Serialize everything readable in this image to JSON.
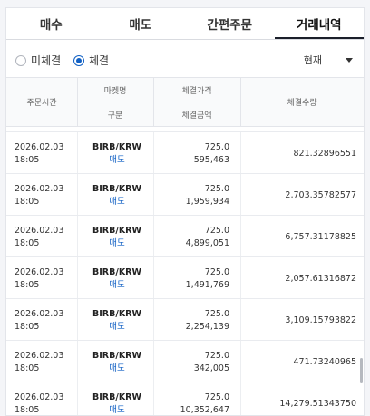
{
  "tabs": [
    {
      "label": "매수",
      "active": false
    },
    {
      "label": "매도",
      "active": false
    },
    {
      "label": "간편주문",
      "active": false
    },
    {
      "label": "거래내역",
      "active": true
    }
  ],
  "filter": {
    "unfilled_label": "미체결",
    "filled_label": "체결",
    "selected": "체결",
    "period_value": "현재"
  },
  "table_header": {
    "order_time": "주문시간",
    "market": "마켓명",
    "side": "구분",
    "price": "체결가격",
    "amount": "체결금액",
    "quantity": "체결수량"
  },
  "rows": [
    {
      "date": "2026.02.03",
      "time": "18:05",
      "market": "BIRB/KRW",
      "side": "매도",
      "price": "725.0",
      "amount": "595,463",
      "quantity": "821.32896551"
    },
    {
      "date": "2026.02.03",
      "time": "18:05",
      "market": "BIRB/KRW",
      "side": "매도",
      "price": "725.0",
      "amount": "1,959,934",
      "quantity": "2,703.35782577"
    },
    {
      "date": "2026.02.03",
      "time": "18:05",
      "market": "BIRB/KRW",
      "side": "매도",
      "price": "725.0",
      "amount": "4,899,051",
      "quantity": "6,757.31178825"
    },
    {
      "date": "2026.02.03",
      "time": "18:05",
      "market": "BIRB/KRW",
      "side": "매도",
      "price": "725.0",
      "amount": "1,491,769",
      "quantity": "2,057.61316872"
    },
    {
      "date": "2026.02.03",
      "time": "18:05",
      "market": "BIRB/KRW",
      "side": "매도",
      "price": "725.0",
      "amount": "2,254,139",
      "quantity": "3,109.15793822"
    },
    {
      "date": "2026.02.03",
      "time": "18:05",
      "market": "BIRB/KRW",
      "side": "매도",
      "price": "725.0",
      "amount": "342,005",
      "quantity": "471.73240965"
    },
    {
      "date": "2026.02.03",
      "time": "18:05",
      "market": "BIRB/KRW",
      "side": "매도",
      "price": "725.0",
      "amount": "10,352,647",
      "quantity": "14,279.51343750"
    }
  ],
  "colors": {
    "accent": "#1261c4",
    "sell": "#1261c4",
    "tab_underline": "#1b1f2a"
  }
}
